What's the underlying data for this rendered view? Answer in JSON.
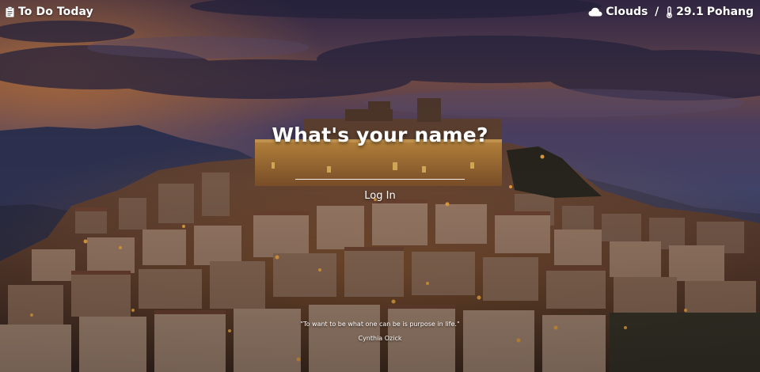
{
  "app": {
    "title": "To Do Today",
    "icon": "clipboard-icon"
  },
  "weather": {
    "condition": "Clouds",
    "separator": " / ",
    "temperature": "29.1",
    "city": "Pohang",
    "condition_icon": "cloud-icon",
    "temperature_icon": "thermometer-icon"
  },
  "login": {
    "prompt": "What's your name?",
    "input_value": "",
    "input_placeholder": "",
    "button_label": "Log In"
  },
  "quote": {
    "text": "\"To want to be what one can be is purpose in life.\"",
    "author": "Cynthia Ozick"
  },
  "background": {
    "description_free": true,
    "accent_light": "#ffb347",
    "sky_top": "#3a2f55",
    "sky_dusk": "#c46d3c"
  }
}
